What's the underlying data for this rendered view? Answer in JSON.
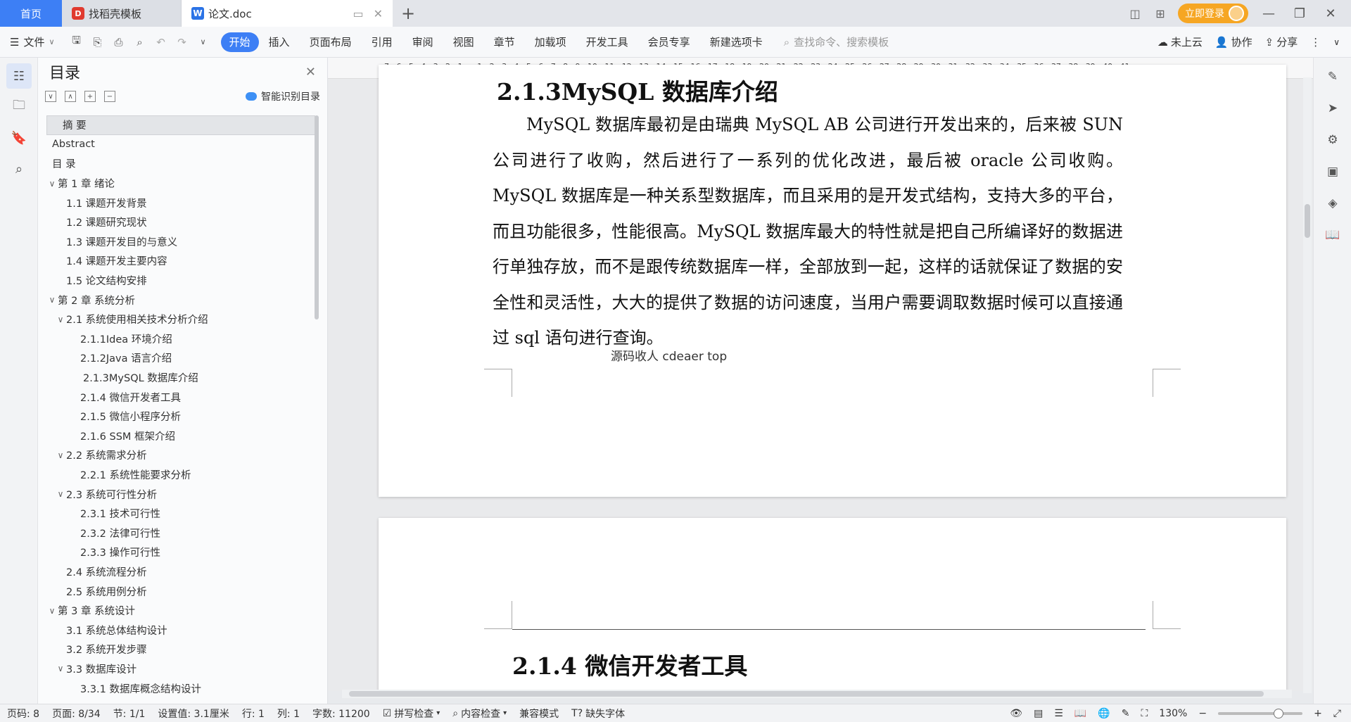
{
  "titlebar": {
    "home_tab": "首页",
    "tabs": [
      {
        "label": "找稻壳模板"
      },
      {
        "label": "论文.doc"
      }
    ],
    "login_label": "立即登录"
  },
  "toolbar": {
    "file_label": "文件",
    "menus": [
      "开始",
      "插入",
      "页面布局",
      "引用",
      "审阅",
      "视图",
      "章节",
      "加载项",
      "开发工具",
      "会员专享",
      "新建选项卡"
    ],
    "search_placeholder": "查找命令、搜索模板",
    "cloud_label": "未上云",
    "collab_label": "协作",
    "share_label": "分享"
  },
  "toc": {
    "title": "目录",
    "smart_label": "智能识别目录",
    "items": [
      {
        "label": "摘  要",
        "level": 0,
        "chev": ""
      },
      {
        "label": "Abstract",
        "level": 0,
        "chev": ""
      },
      {
        "label": "目  录",
        "level": 0,
        "chev": ""
      },
      {
        "label": "第 1 章   绪论",
        "level": 0,
        "chev": "∨"
      },
      {
        "label": "1.1 课题开发背景",
        "level": 1,
        "chev": ""
      },
      {
        "label": "1.2 课题研究现状",
        "level": 1,
        "chev": ""
      },
      {
        "label": "1.3 课题开发目的与意义",
        "level": 1,
        "chev": ""
      },
      {
        "label": "1.4 课题开发主要内容",
        "level": 1,
        "chev": ""
      },
      {
        "label": "1.5 论文结构安排",
        "level": 1,
        "chev": ""
      },
      {
        "label": "第 2 章  系统分析",
        "level": 0,
        "chev": "∨"
      },
      {
        "label": "2.1 系统使用相关技术分析介绍",
        "level": 1,
        "chev": "∨"
      },
      {
        "label": "2.1.1Idea 环境介绍",
        "level": 2,
        "chev": ""
      },
      {
        "label": "2.1.2Java 语言介绍",
        "level": 2,
        "chev": ""
      },
      {
        "label": "2.1.3MySQL 数据库介绍",
        "level": 2,
        "chev": ""
      },
      {
        "label": "2.1.4 微信开发者工具",
        "level": 2,
        "chev": ""
      },
      {
        "label": "2.1.5 微信小程序分析",
        "level": 2,
        "chev": ""
      },
      {
        "label": "2.1.6 SSM 框架介绍",
        "level": 2,
        "chev": ""
      },
      {
        "label": "2.2 系统需求分析",
        "level": 1,
        "chev": "∨"
      },
      {
        "label": "2.2.1 系统性能要求分析",
        "level": 2,
        "chev": ""
      },
      {
        "label": "2.3 系统可行性分析",
        "level": 1,
        "chev": "∨"
      },
      {
        "label": "2.3.1 技术可行性",
        "level": 2,
        "chev": ""
      },
      {
        "label": "2.3.2 法律可行性",
        "level": 2,
        "chev": ""
      },
      {
        "label": "2.3.3 操作可行性",
        "level": 2,
        "chev": ""
      },
      {
        "label": "2.4 系统流程分析",
        "level": 1,
        "chev": ""
      },
      {
        "label": "2.5 系统用例分析",
        "level": 1,
        "chev": ""
      },
      {
        "label": "第 3 章  系统设计",
        "level": 0,
        "chev": "∨"
      },
      {
        "label": "3.1 系统总体结构设计",
        "level": 1,
        "chev": ""
      },
      {
        "label": "3.2 系统开发步骤",
        "level": 1,
        "chev": ""
      },
      {
        "label": "3.3 数据库设计",
        "level": 1,
        "chev": "∨"
      },
      {
        "label": "3.3.1 数据库概念结构设计",
        "level": 2,
        "chev": ""
      }
    ]
  },
  "ruler": {
    "numbers": [
      "7",
      "6",
      "5",
      "4",
      "3",
      "2",
      "1",
      "",
      "1",
      "2",
      "3",
      "4",
      "5",
      "6",
      "7",
      "8",
      "9",
      "10",
      "11",
      "12",
      "13",
      "14",
      "15",
      "16",
      "17",
      "18",
      "19",
      "20",
      "21",
      "22",
      "23",
      "24",
      "25",
      "26",
      "27",
      "28",
      "29",
      "30",
      "31",
      "32",
      "33",
      "34",
      "35",
      "36",
      "37",
      "38",
      "39",
      "40",
      "41"
    ]
  },
  "document": {
    "heading1": "2.1.3MySQL 数据库介绍",
    "paragraph1": "MySQL 数据库最初是由瑞典 MySQL AB 公司进行开发出来的，后来被 SUN 公司进行了收购，然后进行了一系列的优化改进，最后被 oracle 公司收购。MySQL 数据库是一种关系型数据库，而且采用的是开发式结构，支持大多的平台，而且功能很多，性能很高。MySQL 数据库最大的特性就是把自己所编译好的数据进行单独存放，而不是跟传统数据库一样，全部放到一起，这样的话就保证了数据的安全性和灵活性，大大的提供了数据的访问速度，当用户需要调取数据时候可以直接通过 sql 语句进行查询。",
    "overlay": "源码收人 cdeaer top",
    "heading2": "2.1.4 微信开发者工具"
  },
  "statusbar": {
    "page_code": "页码: 8",
    "page": "页面: 8/34",
    "section": "节: 1/1",
    "setting": "设置值: 3.1厘米",
    "row": "行: 1",
    "col": "列: 1",
    "words": "字数: 11200",
    "spellcheck": "拼写检查",
    "content_check": "内容检查",
    "compat": "兼容模式",
    "missing_font": "缺失字体",
    "zoom": "130%",
    "zoom_level": 0.72
  }
}
